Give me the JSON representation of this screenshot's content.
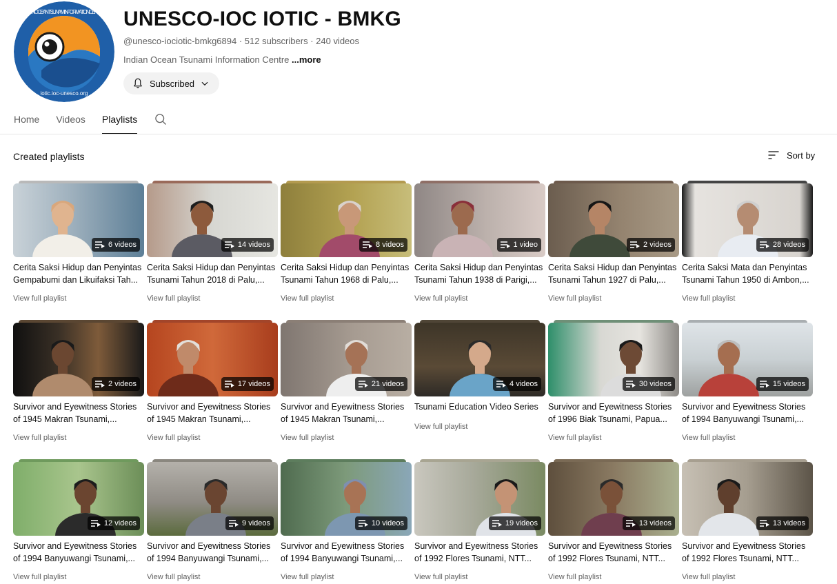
{
  "channel": {
    "title": "UNESCO-IOC IOTIC - BMKG",
    "handle": "@unesco-iociotic-bmkg6894",
    "separator": " · ",
    "subscribers": "512 subscribers",
    "videos": "240 videos",
    "description": "Indian Ocean Tsunami Information Centre ",
    "more": "...more",
    "subscribe_label": "Subscribed",
    "logo_text_top": "INDIAN OCEAN TSUNAMI INFORMATION CENTRE",
    "logo_text_bottom": "iotic.ioc-unesco.org"
  },
  "tabs": [
    {
      "label": "Home"
    },
    {
      "label": "Videos"
    },
    {
      "label": "Playlists"
    }
  ],
  "section": {
    "title": "Created playlists",
    "sort_label": "Sort by"
  },
  "playlists": [
    {
      "title": "Cerita Saksi Hidup dan Penyintas Gempabumi dan Likuifaksi Tah...",
      "count": "6 videos",
      "link": "View full playlist"
    },
    {
      "title": "Cerita Saksi Hidup dan Penyintas Tsunami Tahun 2018 di Palu,...",
      "count": "14 videos",
      "link": "View full playlist"
    },
    {
      "title": "Cerita Saksi Hidup dan Penyintas Tsunami Tahun 1968 di Palu,...",
      "count": "8 videos",
      "link": "View full playlist"
    },
    {
      "title": "Cerita Saksi Hidup dan Penyintas Tsunami Tahun 1938 di Parigi,...",
      "count": "1 video",
      "link": "View full playlist"
    },
    {
      "title": "Cerita Saksi Hidup dan Penyintas Tsunami Tahun 1927 di Palu,...",
      "count": "2 videos",
      "link": "View full playlist"
    },
    {
      "title": "Cerita Saksi Mata dan Penyintas Tsunami Tahun 1950 di Ambon,...",
      "count": "28 videos",
      "link": "View full playlist"
    },
    {
      "title": "Survivor and Eyewitness Stories of 1945 Makran Tsunami,...",
      "count": "2 videos",
      "link": "View full playlist"
    },
    {
      "title": "Survivor and Eyewitness Stories of 1945 Makran Tsunami,...",
      "count": "17 videos",
      "link": "View full playlist"
    },
    {
      "title": "Survivor and Eyewitness Stories of 1945 Makran Tsunami,...",
      "count": "21 videos",
      "link": "View full playlist"
    },
    {
      "title": "Tsunami Education Video Series",
      "count": "4 videos",
      "link": "View full playlist"
    },
    {
      "title": "Survivor and Eyewitness Stories of 1996 Biak Tsunami, Papua...",
      "count": "30 videos",
      "link": "View full playlist"
    },
    {
      "title": "Survivor and Eyewitness Stories of 1994 Banyuwangi Tsunami,...",
      "count": "15 videos",
      "link": "View full playlist"
    },
    {
      "title": "Survivor and Eyewitness Stories of 1994 Banyuwangi Tsunami,...",
      "count": "12 videos",
      "link": "View full playlist"
    },
    {
      "title": "Survivor and Eyewitness Stories of 1994 Banyuwangi Tsunami,...",
      "count": "9 videos",
      "link": "View full playlist"
    },
    {
      "title": "Survivor and Eyewitness Stories of 1994 Banyuwangi Tsunami,...",
      "count": "10 videos",
      "link": "View full playlist"
    },
    {
      "title": "Survivor and Eyewitness Stories of 1992 Flores Tsunami, NTT...",
      "count": "19 videos",
      "link": "View full playlist"
    },
    {
      "title": "Survivor and Eyewitness Stories of 1992 Flores Tsunami, NTT...",
      "count": "13 videos",
      "link": "View full playlist"
    },
    {
      "title": "Survivor and Eyewitness Stories of 1992 Flores Tsunami, NTT...",
      "count": "13 videos",
      "link": "View full playlist"
    }
  ],
  "colors": {
    "text_primary": "#0f0f0f",
    "text_secondary": "#606060",
    "logo_blue": "#1f5fa8",
    "logo_orange": "#f29422"
  }
}
